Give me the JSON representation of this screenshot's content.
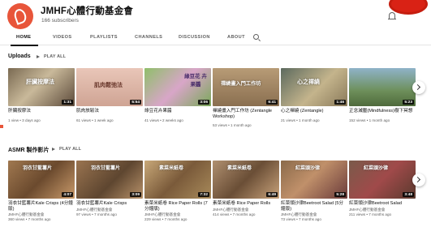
{
  "channel": {
    "name": "JMHF心體行動基金會",
    "subscribers": "166 subscribers"
  },
  "tabs": [
    "HOME",
    "VIDEOS",
    "PLAYLISTS",
    "CHANNELS",
    "DISCUSSION",
    "ABOUT"
  ],
  "active_tab": "HOME",
  "sections": [
    {
      "title": "Uploads",
      "play_all": "PLAY ALL",
      "videos": [
        {
          "title": "肝臟按摩法",
          "meta": "1 view • 3 days ago",
          "duration": "1:31",
          "overlay": "肝臟按摩法"
        },
        {
          "title": "肌肉放鬆法",
          "meta": "61 views • 1 week ago",
          "duration": "5:54",
          "overlay": "肌肉鬆弛法"
        },
        {
          "title": "綠豆花卉果醬",
          "meta": "41 views • 2 weeks ago",
          "duration": "3:06",
          "overlay": "綠豆花 卉果醬"
        },
        {
          "title": "禪繞畫入門工作坊 (Zentangle Workshop)",
          "meta": "53 views • 1 month ago",
          "duration": "6:41",
          "overlay": "禪繞畫入門工作坊"
        },
        {
          "title": "心之禪繞 (Zentangle)",
          "meta": "21 views • 1 month ago",
          "duration": "1:46",
          "overlay": "心之禪繞"
        },
        {
          "title": "正念減壓(Mindfulness)樹下冥想",
          "meta": "152 views • 1 month ago",
          "duration": "5:23",
          "overlay": ""
        }
      ]
    },
    {
      "title": "ASMR 製作影片",
      "play_all": "PLAY ALL",
      "videos": [
        {
          "title": "羽衣甘藍薯片Kale Crisps (4分鐘版)",
          "channel": "JMHF心體行動基金會",
          "meta": "360 views • 7 months ago",
          "duration": "4:07",
          "overlay": "羽衣甘藍薯片"
        },
        {
          "title": "羽衣甘藍薯片Kale Crisps",
          "channel": "JMHF心體行動基金會",
          "meta": "97 views • 7 months ago",
          "duration": "3:09",
          "overlay": "羽衣甘藍薯片"
        },
        {
          "title": "素菜米紙卷 Rice Paper Rolls (7分鐘版)",
          "channel": "JMHF心體行動基金會",
          "meta": "229 views • 7 months ago",
          "duration": "7:32",
          "overlay": "素菜米紙卷"
        },
        {
          "title": "素菜米紙卷 Rice Paper Rolls",
          "channel": "JMHF心體行動基金會",
          "meta": "414 views • 7 months ago",
          "duration": "6:49",
          "overlay": "素菜米紙卷"
        },
        {
          "title": "紅菜頭沙律Beetroot Salad (5分鐘版)",
          "channel": "JMHF心體行動基金會",
          "meta": "73 views • 7 months ago",
          "duration": "5:28",
          "overlay": "紅菜頭沙律"
        },
        {
          "title": "紅菜頭沙律Beetroot Salad",
          "channel": "JMHF心體行動基金會",
          "meta": "211 views • 7 months ago",
          "duration": "3:48",
          "overlay": "紅菜頭沙律"
        }
      ]
    }
  ],
  "colors": {
    "accent": "#d92215",
    "meta_text": "#606060"
  },
  "icons": [
    "search-icon",
    "bell-icon",
    "play-all-icon",
    "next-arrow-icon"
  ]
}
